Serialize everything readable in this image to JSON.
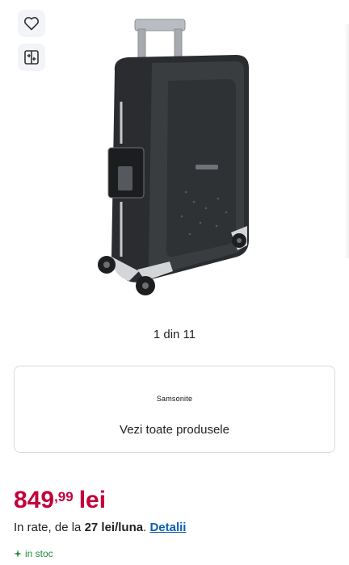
{
  "gallery": {
    "counter": "1 din 11",
    "actions": [
      "heart-icon",
      "compare-icon"
    ]
  },
  "brand": {
    "logo_text": "Samsonite",
    "link_text": "Vezi toate produsele"
  },
  "price": {
    "integer": "849",
    "decimal": ",99",
    "currency": "lei",
    "color": "#c4003a"
  },
  "installment": {
    "prefix": "In rate, de la ",
    "amount": "27 lei/luna",
    "suffix": ". ",
    "link": "Detalii"
  },
  "stock": {
    "icon": "sparkle-icon",
    "text": "in stoc",
    "color": "#1f8a3c"
  }
}
